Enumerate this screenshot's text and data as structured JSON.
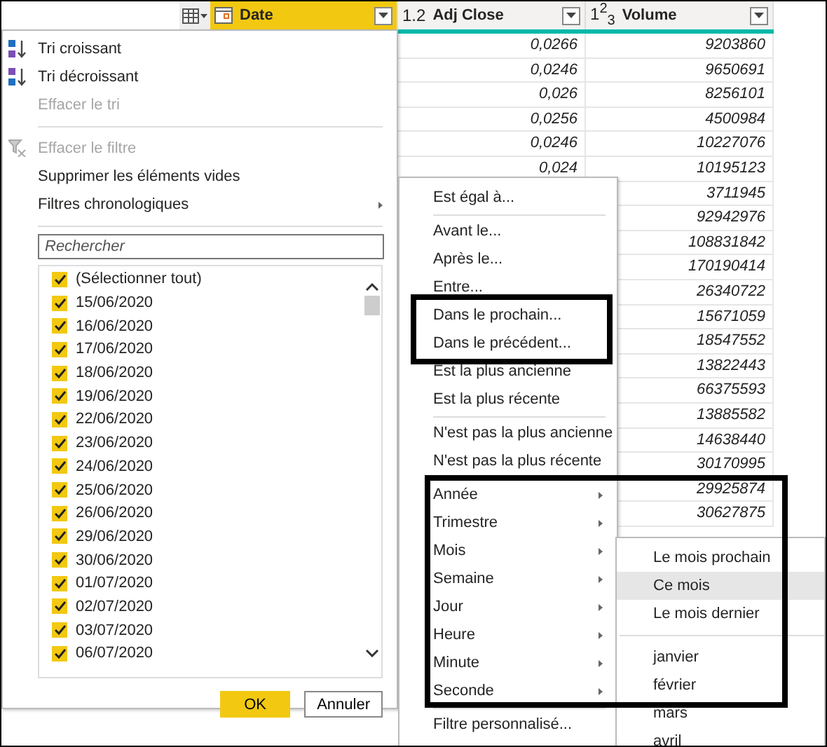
{
  "table": {
    "columns": [
      {
        "kind": "date",
        "label": "Date",
        "selected": true
      },
      {
        "kind": "decimal",
        "type_label": "1.2",
        "label": "Adj Close",
        "selected": false,
        "values": [
          "0,0266",
          "0,0246",
          "0,026",
          "0,0256",
          "0,0246",
          "0,024"
        ]
      },
      {
        "kind": "integer",
        "type_label": "1$^{2}$$_{3}$",
        "label": "Volume",
        "selected": false,
        "values": [
          "9203860",
          "9650691",
          "8256101",
          "4500984",
          "10227076",
          "10195123",
          "3711945",
          "92942976",
          "108831842",
          "170190414",
          "26340722",
          "15671059",
          "18547552",
          "13822443",
          "66375593",
          "13885582",
          "14638440",
          "30170995",
          "29925874",
          "30627875"
        ]
      }
    ]
  },
  "filter_menu": {
    "items": [
      {
        "kind": "sort_asc",
        "label": "Tri croissant",
        "disabled": false
      },
      {
        "kind": "sort_desc",
        "label": "Tri décroissant",
        "disabled": false
      },
      {
        "kind": "item",
        "label": "Effacer le tri",
        "disabled": true
      },
      {
        "kind": "separator"
      },
      {
        "kind": "clear_filter",
        "label": "Effacer le filtre",
        "disabled": true
      },
      {
        "kind": "item",
        "label": "Supprimer les éléments vides",
        "disabled": false
      },
      {
        "kind": "submenu",
        "label": "Filtres chronologiques",
        "disabled": false
      },
      {
        "kind": "separator"
      }
    ],
    "search": {
      "placeholder": "Rechercher"
    },
    "values": [
      {
        "label": "(Sélectionner tout)",
        "checked": true
      },
      {
        "label": "15/06/2020",
        "checked": true
      },
      {
        "label": "16/06/2020",
        "checked": true
      },
      {
        "label": "17/06/2020",
        "checked": true
      },
      {
        "label": "18/06/2020",
        "checked": true
      },
      {
        "label": "19/06/2020",
        "checked": true
      },
      {
        "label": "22/06/2020",
        "checked": true
      },
      {
        "label": "23/06/2020",
        "checked": true
      },
      {
        "label": "24/06/2020",
        "checked": true
      },
      {
        "label": "25/06/2020",
        "checked": true
      },
      {
        "label": "26/06/2020",
        "checked": true
      },
      {
        "label": "29/06/2020",
        "checked": true
      },
      {
        "label": "30/06/2020",
        "checked": true
      },
      {
        "label": "01/07/2020",
        "checked": true
      },
      {
        "label": "02/07/2020",
        "checked": true
      },
      {
        "label": "03/07/2020",
        "checked": true
      },
      {
        "label": "06/07/2020",
        "checked": true
      }
    ],
    "buttons": [
      {
        "kind": "primary",
        "label": "OK"
      },
      {
        "kind": "secondary",
        "label": "Annuler"
      }
    ]
  },
  "date_filters_menu": {
    "items": [
      {
        "kind": "item",
        "label": "Est égal à..."
      },
      {
        "kind": "separator"
      },
      {
        "kind": "item",
        "label": "Avant le..."
      },
      {
        "kind": "item",
        "label": "Après le..."
      },
      {
        "kind": "item",
        "label": "Entre..."
      },
      {
        "kind": "item",
        "label": "Dans le prochain..."
      },
      {
        "kind": "item",
        "label": "Dans le précédent..."
      },
      {
        "kind": "item",
        "label": "Est la plus ancienne"
      },
      {
        "kind": "item",
        "label": "Est la plus récente"
      },
      {
        "kind": "separator"
      },
      {
        "kind": "item",
        "label": "N'est pas la plus ancienne"
      },
      {
        "kind": "item",
        "label": "N'est pas la plus récente"
      },
      {
        "kind": "separator"
      },
      {
        "kind": "submenu",
        "label": "Année"
      },
      {
        "kind": "submenu",
        "label": "Trimestre"
      },
      {
        "kind": "submenu",
        "label": "Mois"
      },
      {
        "kind": "submenu",
        "label": "Semaine"
      },
      {
        "kind": "submenu",
        "label": "Jour"
      },
      {
        "kind": "submenu",
        "label": "Heure"
      },
      {
        "kind": "submenu",
        "label": "Minute"
      },
      {
        "kind": "submenu",
        "label": "Seconde"
      },
      {
        "kind": "separator"
      },
      {
        "kind": "item",
        "label": "Filtre personnalisé..."
      }
    ]
  },
  "month_menu": {
    "items": [
      {
        "kind": "item",
        "label": "Le mois prochain",
        "selected": false
      },
      {
        "kind": "item",
        "label": "Ce mois",
        "selected": true
      },
      {
        "kind": "item",
        "label": "Le mois dernier",
        "selected": false
      },
      {
        "kind": "separator"
      },
      {
        "kind": "item",
        "label": "janvier",
        "selected": false
      },
      {
        "kind": "item",
        "label": "février",
        "selected": false
      },
      {
        "kind": "item",
        "label": "mars",
        "selected": false
      },
      {
        "kind": "item",
        "label": "avril",
        "selected": false
      }
    ]
  }
}
